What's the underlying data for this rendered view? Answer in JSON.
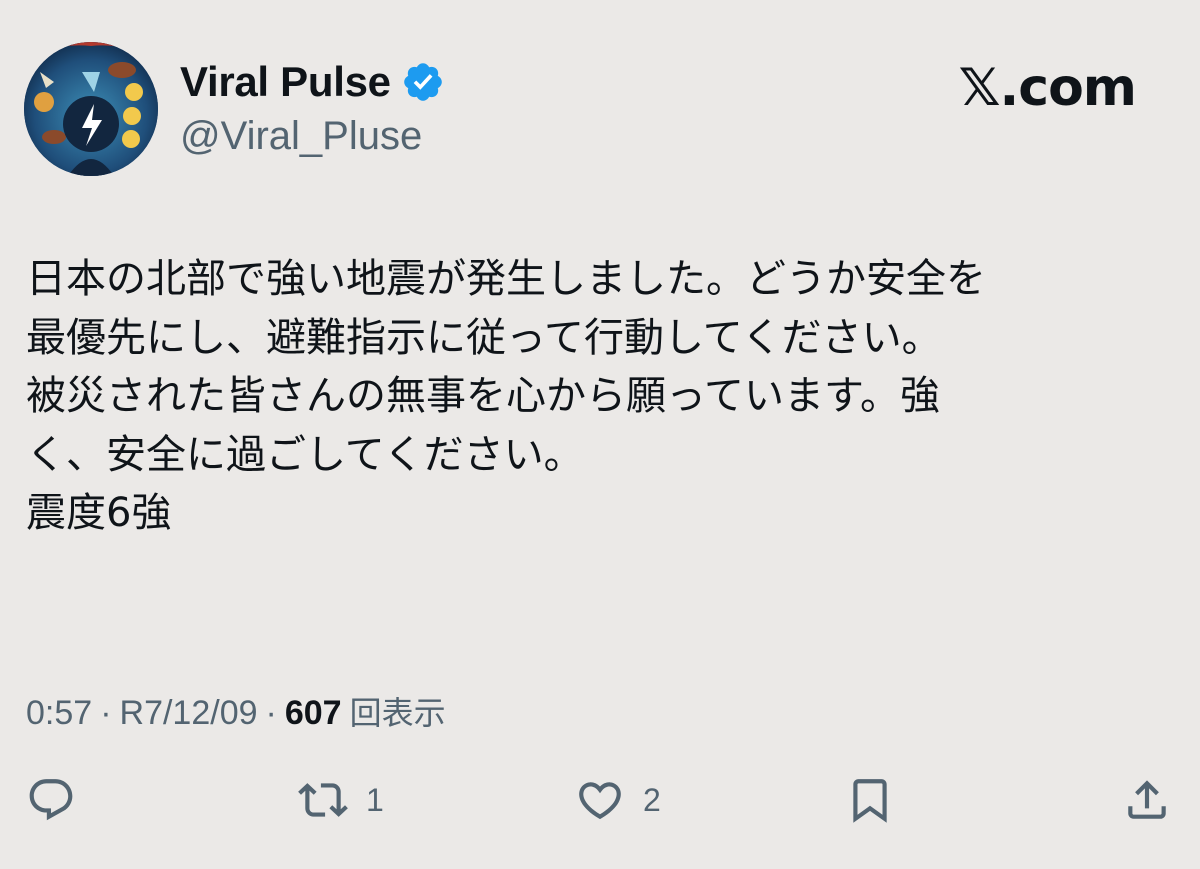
{
  "author": {
    "display_name": "Viral Pulse",
    "handle": "@Viral_Pluse",
    "verified_icon": "verified-badge-icon"
  },
  "brand": {
    "label": "𝕏.com"
  },
  "tweet": {
    "text": "日本の北部で強い地震が発生しました。どうか安全を\n最優先にし、避難指示に従って行動してください。\n被災された皆さんの無事を心から願っています。強\nく、安全に過ごしてください。\n震度6強"
  },
  "meta": {
    "time": "0:57",
    "sep1": "·",
    "date": "R7/12/09",
    "sep2": "·",
    "views_count": "607",
    "views_label": "回表示"
  },
  "actions": {
    "reply": {
      "icon": "reply-icon",
      "count": ""
    },
    "retweet": {
      "icon": "retweet-icon",
      "count": "1"
    },
    "like": {
      "icon": "heart-icon",
      "count": "2"
    },
    "bookmark": {
      "icon": "bookmark-icon",
      "count": ""
    },
    "share": {
      "icon": "share-icon",
      "count": ""
    }
  },
  "colors": {
    "background": "#ebe9e7",
    "text": "#0f1419",
    "secondary": "#536471",
    "verified": "#1d9bf0"
  }
}
